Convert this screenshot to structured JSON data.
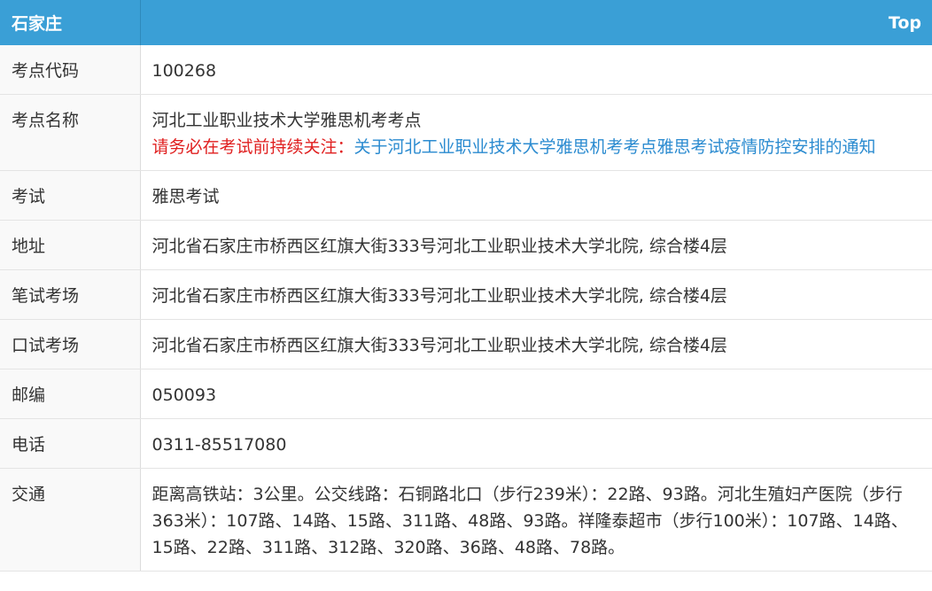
{
  "header": {
    "city": "石家庄",
    "top_link": "Top"
  },
  "rows": {
    "code": {
      "label": "考点代码",
      "value": "100268"
    },
    "name": {
      "label": "考点名称",
      "value": "河北工业职业技术大学雅思机考考点",
      "notice_prefix": "请务必在考试前持续关注：",
      "notice_link": "关于河北工业职业技术大学雅思机考考点雅思考试疫情防控安排的通知"
    },
    "exam": {
      "label": "考试",
      "value": "雅思考试"
    },
    "address": {
      "label": "地址",
      "value": "河北省石家庄市桥西区红旗大街333号河北工业职业技术大学北院, 综合楼4层"
    },
    "written": {
      "label": "笔试考场",
      "value": "河北省石家庄市桥西区红旗大街333号河北工业职业技术大学北院, 综合楼4层"
    },
    "oral": {
      "label": "口试考场",
      "value": "河北省石家庄市桥西区红旗大街333号河北工业职业技术大学北院, 综合楼4层"
    },
    "postcode": {
      "label": "邮编",
      "value": "050093"
    },
    "phone": {
      "label": "电话",
      "value": "0311-85517080"
    },
    "transport": {
      "label": "交通",
      "value": "距离高铁站：3公里。公交线路：石铜路北口（步行239米）：22路、93路。河北生殖妇产医院（步行363米）：107路、14路、15路、311路、48路、93路。祥隆泰超市（步行100米）：107路、14路、15路、22路、311路、312路、320路、36路、48路、78路。"
    }
  },
  "colors": {
    "header_bg": "#3a9fd6",
    "notice_red": "#e02020",
    "link_blue": "#2b8bd0"
  }
}
